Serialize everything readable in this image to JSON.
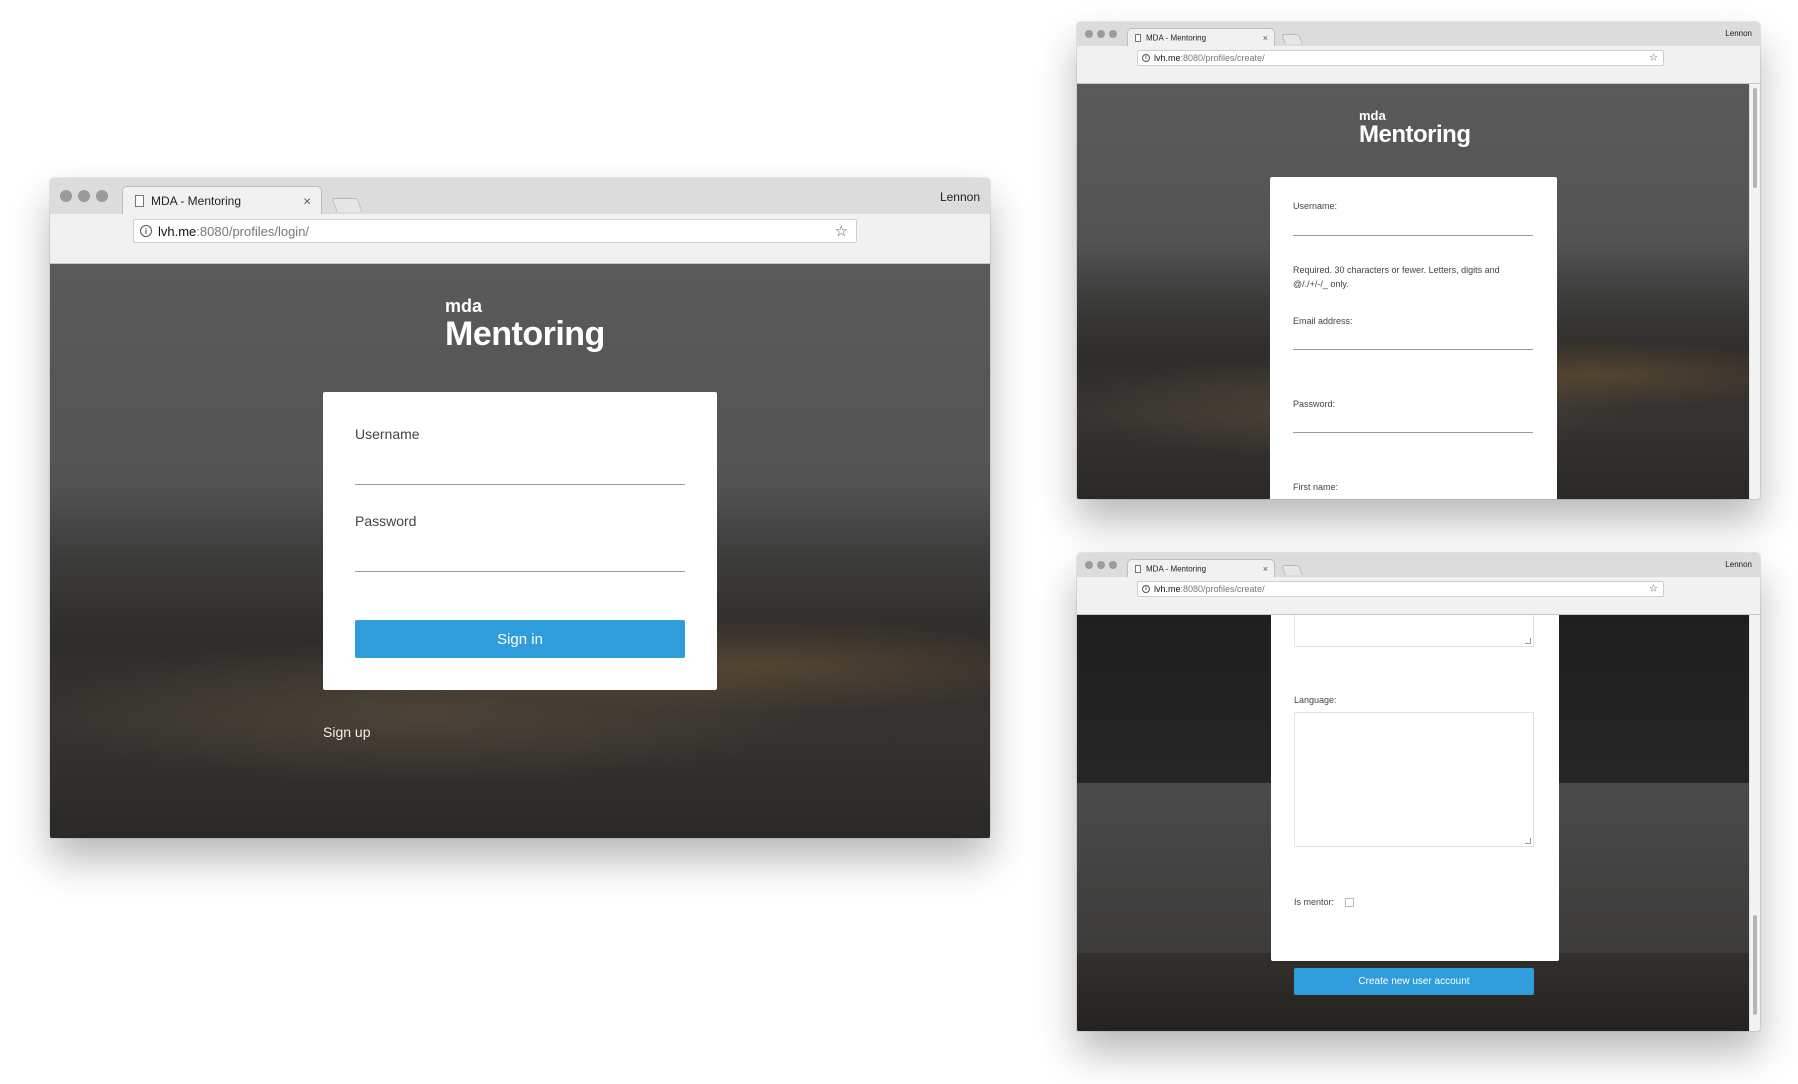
{
  "login_window": {
    "tab_title": "MDA - Mentoring",
    "profile": "Lennon",
    "url_host": "lvh.me",
    "url_path": ":8080/profiles/login/",
    "logo_small": "mda",
    "logo_big": "Mentoring",
    "username_label": "Username",
    "password_label": "Password",
    "signin_label": "Sign in",
    "signup_label": "Sign up"
  },
  "signup_window_top": {
    "tab_title": "MDA - Mentoring",
    "profile": "Lennon",
    "url_host": "lvh.me",
    "url_path": ":8080/profiles/create/",
    "logo_small": "mda",
    "logo_big": "Mentoring",
    "username_label": "Username:",
    "username_help": "Required. 30 characters or fewer. Letters, digits and @/./+/-/_ only.",
    "email_label": "Email address:",
    "password_label": "Password:",
    "firstname_label": "First name:"
  },
  "signup_window_bottom": {
    "tab_title": "MDA - Mentoring",
    "profile": "Lennon",
    "url_host": "lvh.me",
    "url_path": ":8080/profiles/create/",
    "language_label": "Language:",
    "is_mentor_label": "Is mentor:",
    "create_label": "Create new user account"
  },
  "colors": {
    "accent": "#2f9ddb"
  },
  "icons": [
    "page-icon",
    "close-icon",
    "info-icon",
    "star-icon",
    "new-tab-icon"
  ]
}
